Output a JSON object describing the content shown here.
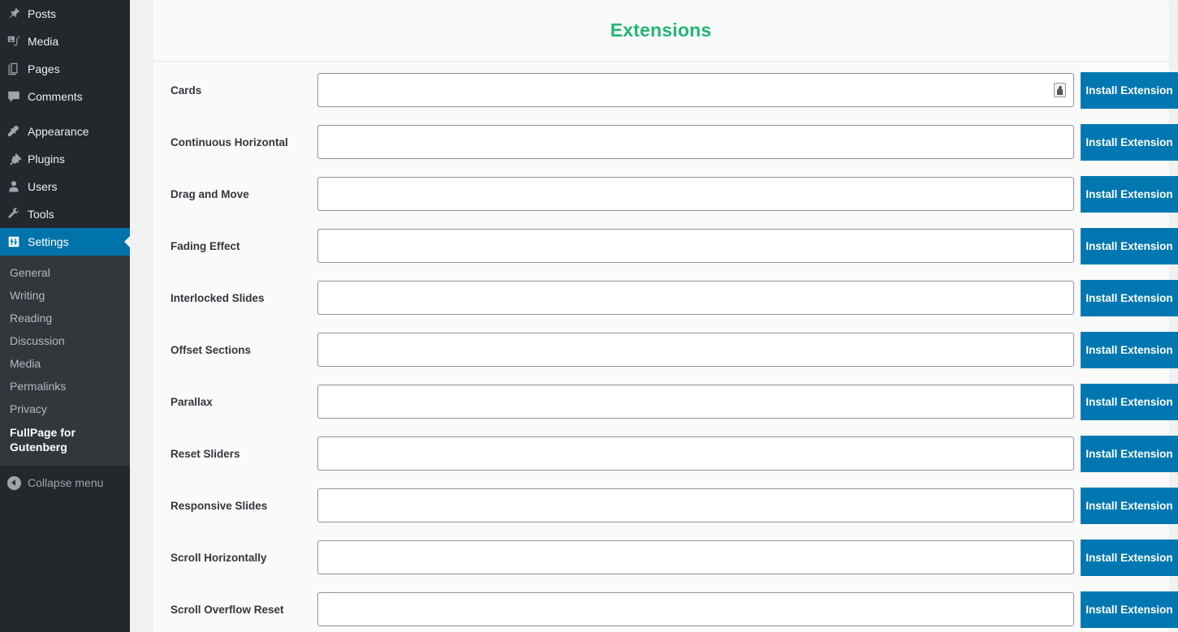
{
  "sidebar": {
    "menu_items": [
      {
        "label": "Posts",
        "icon": "pin-icon",
        "current": false,
        "separator_after": false
      },
      {
        "label": "Media",
        "icon": "media-icon",
        "current": false,
        "separator_after": false
      },
      {
        "label": "Pages",
        "icon": "pages-icon",
        "current": false,
        "separator_after": false
      },
      {
        "label": "Comments",
        "icon": "comments-icon",
        "current": false,
        "separator_after": true
      },
      {
        "label": "Appearance",
        "icon": "appearance-icon",
        "current": false,
        "separator_after": false
      },
      {
        "label": "Plugins",
        "icon": "plugins-icon",
        "current": false,
        "separator_after": false
      },
      {
        "label": "Users",
        "icon": "users-icon",
        "current": false,
        "separator_after": false
      },
      {
        "label": "Tools",
        "icon": "tools-icon",
        "current": false,
        "separator_after": false
      },
      {
        "label": "Settings",
        "icon": "settings-icon",
        "current": true,
        "separator_after": false
      }
    ],
    "submenu_items": [
      {
        "label": "General",
        "current": false
      },
      {
        "label": "Writing",
        "current": false
      },
      {
        "label": "Reading",
        "current": false
      },
      {
        "label": "Discussion",
        "current": false
      },
      {
        "label": "Media",
        "current": false
      },
      {
        "label": "Permalinks",
        "current": false
      },
      {
        "label": "Privacy",
        "current": false
      },
      {
        "label": "FullPage for Gutenberg",
        "current": true
      }
    ],
    "collapse_label": "Collapse menu",
    "collapse_icon": "collapse-arrow-icon",
    "bg_color": "#23282d",
    "submenu_bg_color": "#32373c",
    "current_color": "#0073aa"
  },
  "page": {
    "title": "Extensions",
    "title_color": "#22b573",
    "button_color": "#0077b0",
    "input_placeholder": ""
  },
  "extensions": [
    {
      "label": "Cards",
      "value": "",
      "button": "Install Extension",
      "has_autofill_icon": true
    },
    {
      "label": "Continuous Horizontal",
      "value": "",
      "button": "Install Extension",
      "has_autofill_icon": false
    },
    {
      "label": "Drag and Move",
      "value": "",
      "button": "Install Extension",
      "has_autofill_icon": false
    },
    {
      "label": "Fading Effect",
      "value": "",
      "button": "Install Extension",
      "has_autofill_icon": false
    },
    {
      "label": "Interlocked Slides",
      "value": "",
      "button": "Install Extension",
      "has_autofill_icon": false
    },
    {
      "label": "Offset Sections",
      "value": "",
      "button": "Install Extension",
      "has_autofill_icon": false
    },
    {
      "label": "Parallax",
      "value": "",
      "button": "Install Extension",
      "has_autofill_icon": false
    },
    {
      "label": "Reset Sliders",
      "value": "",
      "button": "Install Extension",
      "has_autofill_icon": false
    },
    {
      "label": "Responsive Slides",
      "value": "",
      "button": "Install Extension",
      "has_autofill_icon": false
    },
    {
      "label": "Scroll Horizontally",
      "value": "",
      "button": "Install Extension",
      "has_autofill_icon": false
    },
    {
      "label": "Scroll Overflow Reset",
      "value": "",
      "button": "Install Extension",
      "has_autofill_icon": false
    }
  ]
}
